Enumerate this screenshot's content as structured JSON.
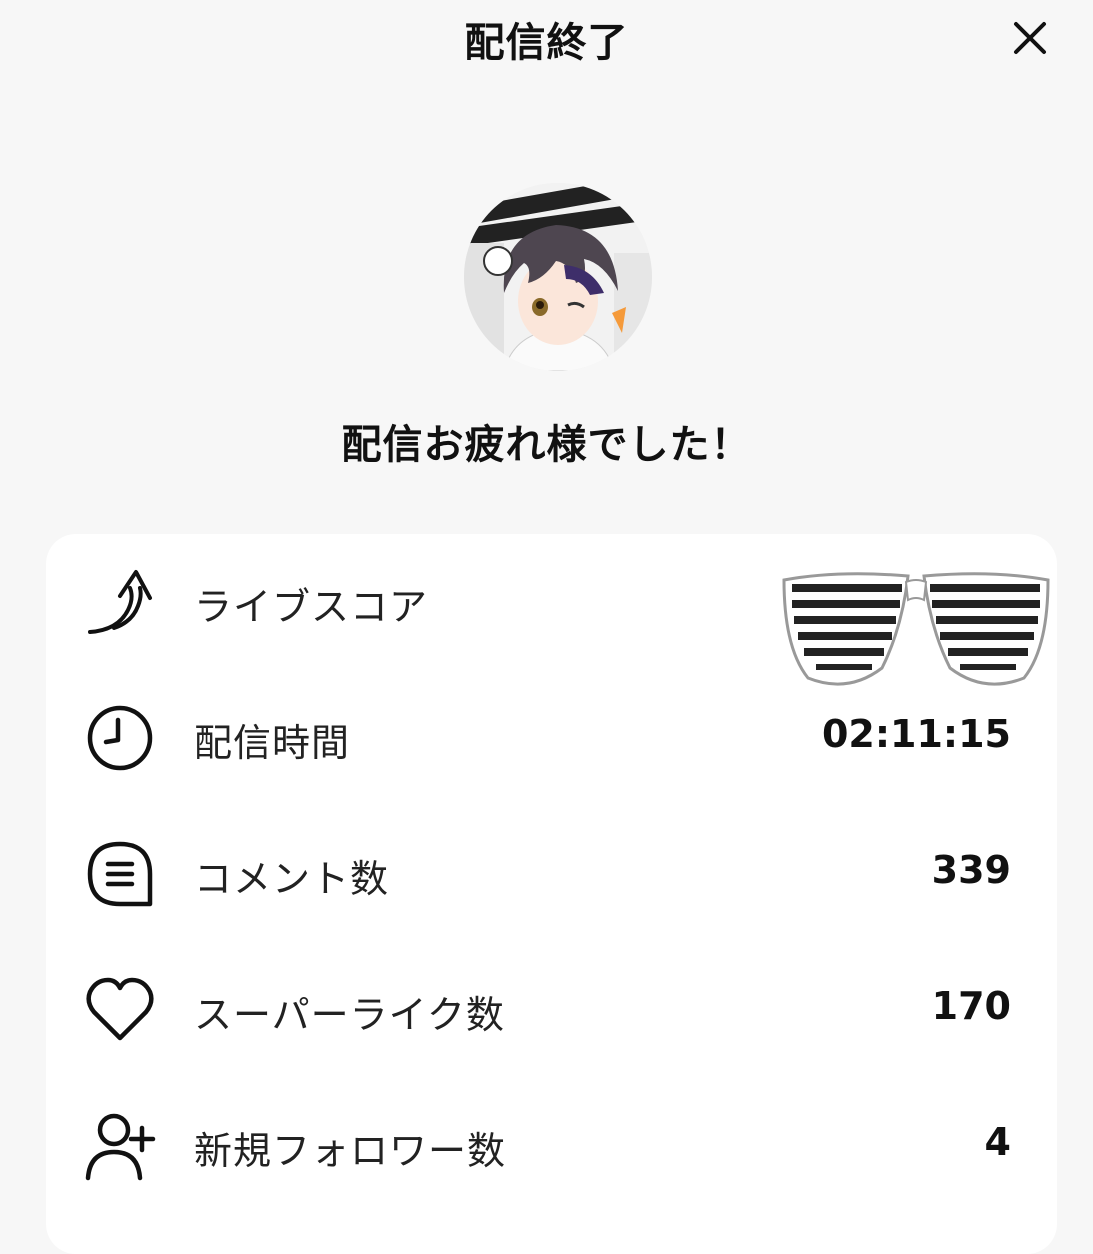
{
  "header": {
    "title": "配信終了",
    "close_icon": "close-icon"
  },
  "message": "配信お疲れ様でした！",
  "stats": [
    {
      "icon": "arrow-up-icon",
      "label": "ライブスコア",
      "value": ""
    },
    {
      "icon": "clock-icon",
      "label": "配信時間",
      "value": "02:11:15"
    },
    {
      "icon": "comment-icon",
      "label": "コメント数",
      "value": "339"
    },
    {
      "icon": "heart-icon",
      "label": "スーパーライク数",
      "value": "170"
    },
    {
      "icon": "user-plus-icon",
      "label": "新規フォロワー数",
      "value": "4"
    }
  ],
  "colors": {
    "background": "#f7f7f7",
    "card": "#ffffff",
    "text": "#111111"
  }
}
